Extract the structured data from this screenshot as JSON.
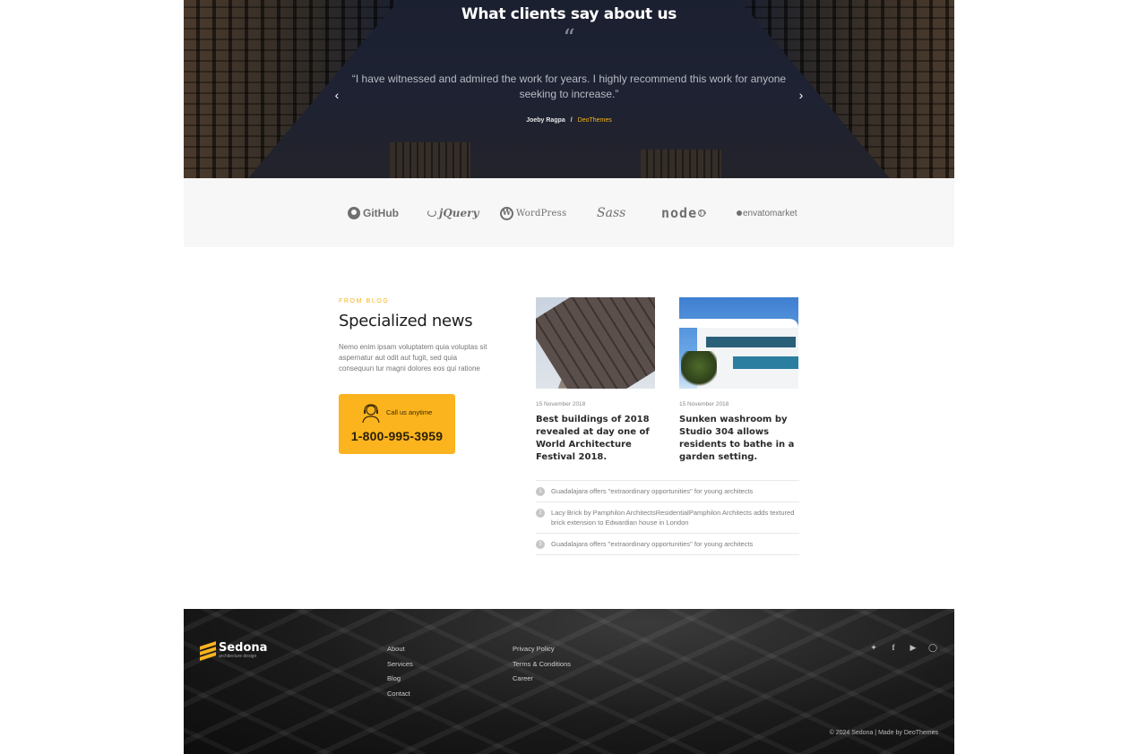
{
  "testimonial": {
    "heading": "What clients say about us",
    "quote_mark": "“",
    "quote": "“I have witnessed and admired the work for years. I highly recommend this work for anyone seeking to increase.”",
    "author": "Joeby Ragpa",
    "separator": "/",
    "company": "DeoThemes",
    "prev_icon": "chevron-left-icon",
    "next_icon": "chevron-right-icon"
  },
  "partners": [
    {
      "name": "GitHub",
      "text": "GitHub"
    },
    {
      "name": "jQuery",
      "text": "jQuery"
    },
    {
      "name": "WordPress",
      "text": "WordPress"
    },
    {
      "name": "Sass",
      "text": "Sass"
    },
    {
      "name": "node",
      "text": "node"
    },
    {
      "name": "envato market",
      "text": "envatomarket"
    }
  ],
  "blog": {
    "eyebrow": "From Blog",
    "title": "Specialized news",
    "description": "Nemo enim ipsam voluptatem quia voluptas sit aspernatur aut odit aut fugit, sed quia consequun tur magni dolores eos qui ratione",
    "call_label": "Call us anytime",
    "phone": "1-800-995-3959",
    "posts": [
      {
        "date": "15 November 2018",
        "title": "Best buildings of 2018 revealed at day one of World Architecture Festival 2018."
      },
      {
        "date": "15 November 2018",
        "title": "Sunken washroom by Studio 304 allows residents to bathe in a garden setting."
      }
    ],
    "list": [
      {
        "num": "1",
        "text": "Guadalajara offers \"extraordinary opportunities\" for young architects"
      },
      {
        "num": "2",
        "text": "Lacy Brick by Pamphilon ArchitectsResidentialPamphilon Architects adds textured brick extension to Edwardian house in London"
      },
      {
        "num": "3",
        "text": "Guadalajara offers \"extraordinary opportunities\" for young architects"
      }
    ]
  },
  "footer": {
    "brand": "Sedona",
    "tagline": "architecture design",
    "col1": [
      "About",
      "Services",
      "Blog",
      "Contact"
    ],
    "col2": [
      "Privacy Policy",
      "Terms & Conditions",
      "Career"
    ],
    "social": [
      "twitter-icon",
      "facebook-icon",
      "youtube-icon",
      "instagram-icon"
    ],
    "copyright": "© 2024 Sedona | Made by DeoThemes"
  },
  "colors": {
    "accent": "#fbb41d",
    "dark": "#111111"
  }
}
